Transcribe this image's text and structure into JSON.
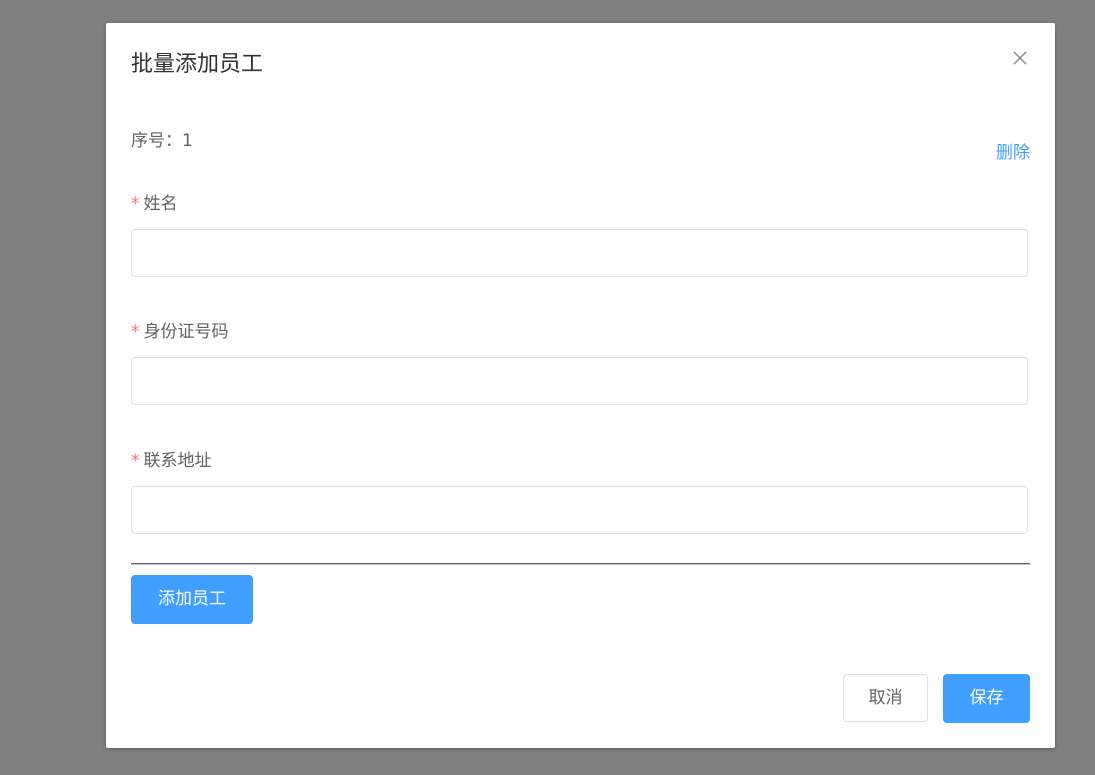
{
  "dialog": {
    "title": "批量添加员工",
    "close_icon": "close-icon"
  },
  "entry": {
    "seq_label": "序号：1",
    "delete_label": "删除",
    "fields": [
      {
        "required_mark": "*",
        "label": "姓名",
        "value": "",
        "placeholder": ""
      },
      {
        "required_mark": "*",
        "label": "身份证号码",
        "value": "",
        "placeholder": ""
      },
      {
        "required_mark": "*",
        "label": "联系地址",
        "value": "",
        "placeholder": ""
      }
    ]
  },
  "actions": {
    "add_label": "添加员工",
    "cancel_label": "取消",
    "save_label": "保存"
  },
  "colors": {
    "primary": "#409eff",
    "required": "#f56c6c",
    "overlay": "#808080"
  }
}
